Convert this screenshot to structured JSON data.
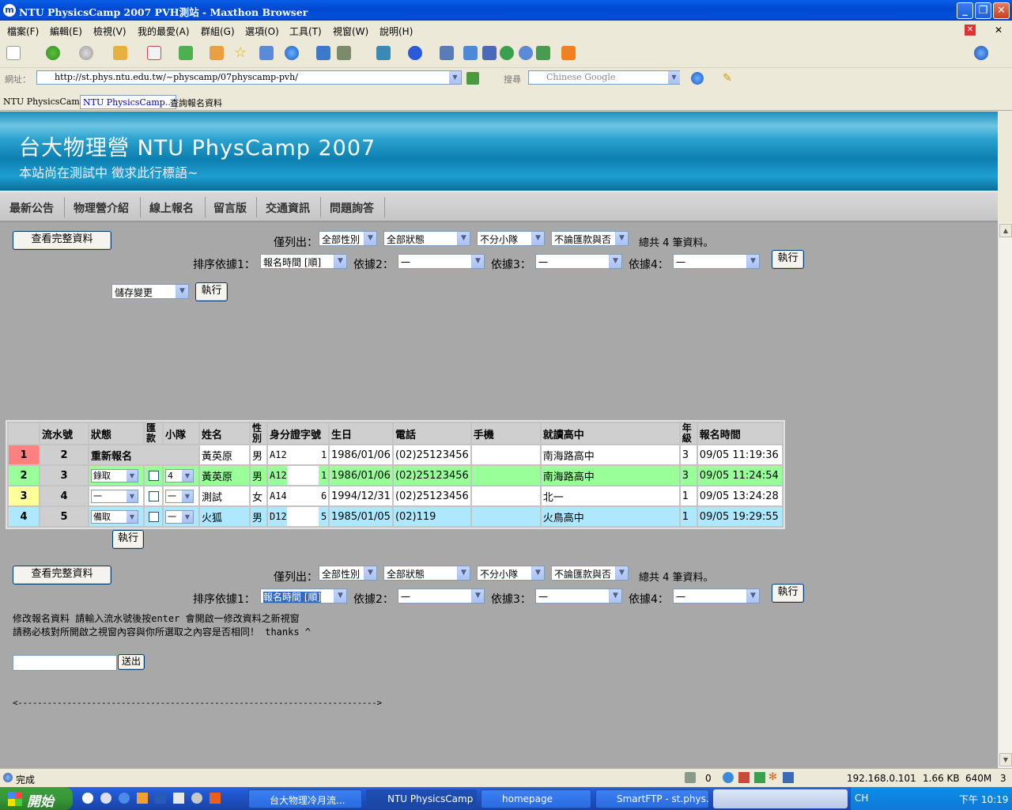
{
  "window": {
    "title": "NTU PhysicsCamp 2007 PVH測站 - Maxthon Browser"
  },
  "menu": [
    "檔案(F)",
    "編輯(E)",
    "檢視(V)",
    "我的最愛(A)",
    "群組(G)",
    "選項(O)",
    "工具(T)",
    "視窗(W)",
    "說明(H)"
  ],
  "address": {
    "label": "網址：",
    "url": "http://st.phys.ntu.edu.tw/~physcamp/07physcamp-pvh/",
    "search_label": "搜尋",
    "search_placeholder": "Chinese Google"
  },
  "tabs": [
    "NTU PhysicsCamp...",
    "NTU PhysicsCamp...",
    "查詢報名資料"
  ],
  "banner": {
    "title": "台大物理營 NTU PhysCamp 2007",
    "subtitle": "本站尚在測試中 徵求此行標語~"
  },
  "nav": [
    "最新公告",
    "物理營介紹",
    "線上報名",
    "留言版",
    "交通資訊",
    "問題詢答"
  ],
  "controls": {
    "view_all": "查看完整資料",
    "filter_label": "僅列出：",
    "gender": "全部性別",
    "status": "全部狀態",
    "team": "不分小隊",
    "paid": "不論匯款與否",
    "total": "總共 4 筆資料。",
    "sort1_label": "排序依據1：",
    "sort1": "報名時間 [順]",
    "sort2_label": "依據2：",
    "sort3_label": "依據3：",
    "sort4_label": "依據4：",
    "dash": "一",
    "execute": "執行",
    "save_change": "儲存變更"
  },
  "table": {
    "headers": [
      "",
      "流水號",
      "狀態",
      "匯款",
      "小隊",
      "姓名",
      "性別",
      "身分證字號",
      "生日",
      "電話",
      "手機",
      "就讀高中",
      "年級",
      "報名時間"
    ],
    "rows": [
      {
        "n": "1",
        "id": "2",
        "status": "重新報名",
        "team": "",
        "name": "黃英原",
        "sex": "男",
        "pid1": "A12",
        "pid2": "1",
        "bday": "1986/01/06",
        "tel": "(02)25123456",
        "mobile": "",
        "school": "南海路高中",
        "grade": "3",
        "time": "09/05 11:19:36",
        "color": "#ffffff",
        "ncolor": "#ff8080"
      },
      {
        "n": "2",
        "id": "3",
        "status": "錄取",
        "team": "4",
        "name": "黃英原",
        "sex": "男",
        "pid1": "A12",
        "pid2": "1",
        "bday": "1986/01/06",
        "tel": "(02)25123456",
        "mobile": "",
        "school": "南海路高中",
        "grade": "3",
        "time": "09/05 11:24:54",
        "color": "#99ff99",
        "ncolor": "#99ff99"
      },
      {
        "n": "3",
        "id": "4",
        "status": "一",
        "team": "一",
        "name": "測試",
        "sex": "女",
        "pid1": "A14",
        "pid2": "6",
        "bday": "1994/12/31",
        "tel": "(02)25123456",
        "mobile": "",
        "school": "北一",
        "grade": "1",
        "time": "09/05 13:24:28",
        "color": "#ffffff",
        "ncolor": "#ffff99"
      },
      {
        "n": "4",
        "id": "5",
        "status": "備取",
        "team": "一",
        "name": "火狐",
        "sex": "男",
        "pid1": "D12",
        "pid2": "5",
        "bday": "1985/01/05",
        "tel": "(02)119",
        "mobile": "",
        "school": "火鳥高中",
        "grade": "1",
        "time": "09/05 19:29:55",
        "color": "#aee8ff",
        "ncolor": "#aee8ff"
      }
    ]
  },
  "notes": {
    "line1": "修改報名資料 請輸入流水號後按enter 會開啟一修改資料之新視窗",
    "line2": "請務必核對所開啟之視窗內容與你所選取之內容是否相同！ thanks ^",
    "submit": "送出",
    "arrow": "<------------------------------------------------------------------------->"
  },
  "status": {
    "text": "完成",
    "count": "0",
    "ip": "192.168.0.101",
    "size": "1.66 KB",
    "mem": "640M",
    "num": "3"
  },
  "taskbar": {
    "start": "開始",
    "tasks": [
      "台大物理冷月流...",
      "NTU PhysicsCamp ...",
      "homepage",
      "SmartFTP - st.phys...."
    ],
    "lang": "CH",
    "time": "下午 10:19"
  }
}
